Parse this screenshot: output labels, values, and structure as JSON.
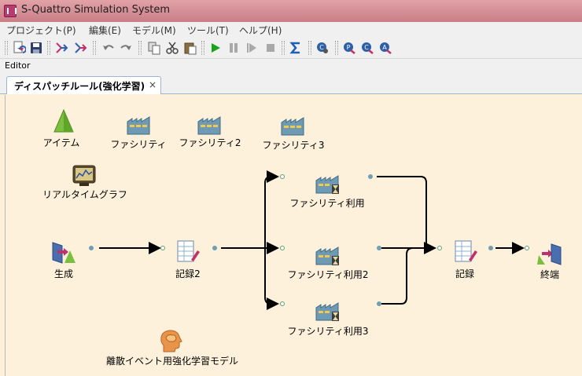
{
  "window": {
    "title": "S-Quattro Simulation System"
  },
  "menu": {
    "items": [
      "プロジェクト(P)",
      "編集(E)",
      "モデル(M)",
      "ツール(T)",
      "ヘルプ(H)"
    ]
  },
  "toolbar": {
    "buttons": [
      {
        "name": "new-icon"
      },
      {
        "name": "save-icon"
      },
      {
        "name": "run-route-icon"
      },
      {
        "name": "route-alt-icon"
      },
      {
        "name": "undo-icon"
      },
      {
        "name": "redo-icon"
      },
      {
        "name": "copy-icon"
      },
      {
        "name": "cut-icon"
      },
      {
        "name": "paste-icon"
      },
      {
        "name": "play-icon"
      },
      {
        "name": "pause-icon"
      },
      {
        "name": "step-icon"
      },
      {
        "name": "stop-icon"
      },
      {
        "name": "sigma-icon"
      },
      {
        "name": "check-icon"
      },
      {
        "name": "p-icon"
      },
      {
        "name": "c-icon"
      },
      {
        "name": "a-icon"
      }
    ]
  },
  "editor": {
    "label": "Editor"
  },
  "tab": {
    "label": "ディスパッチルール(強化学習)",
    "close": "×"
  },
  "colors": {
    "titlebar": "#d08c93",
    "canvas_bg": "#fdf1dc",
    "wire": "#000000",
    "port_out": "#6f9fb0",
    "port_in_border": "#5e9b6f",
    "play_green": "#1aa31a"
  },
  "nodes": [
    {
      "id": "item",
      "label": "アイテム",
      "icon": "cone-icon"
    },
    {
      "id": "facility1",
      "label": "ファシリティ",
      "icon": "factory-icon"
    },
    {
      "id": "facility2",
      "label": "ファシリティ2",
      "icon": "factory-icon"
    },
    {
      "id": "facility3",
      "label": "ファシリティ3",
      "icon": "factory-icon"
    },
    {
      "id": "realtime-graph",
      "label": "リアルタイムグラフ",
      "icon": "monitor-icon"
    },
    {
      "id": "generate",
      "label": "生成",
      "icon": "generate-icon"
    },
    {
      "id": "record2",
      "label": "記録2",
      "icon": "record-icon"
    },
    {
      "id": "facility-use1",
      "label": "ファシリティ利用",
      "icon": "factory-hourglass-icon"
    },
    {
      "id": "facility-use2",
      "label": "ファシリティ利用2",
      "icon": "factory-hourglass-icon"
    },
    {
      "id": "facility-use3",
      "label": "ファシリティ利用3",
      "icon": "factory-hourglass-icon"
    },
    {
      "id": "record",
      "label": "記録",
      "icon": "record-icon"
    },
    {
      "id": "terminate",
      "label": "終端",
      "icon": "exit-icon"
    },
    {
      "id": "rl-model",
      "label": "離散イベント用強化学習モデル",
      "icon": "brain-icon"
    }
  ]
}
